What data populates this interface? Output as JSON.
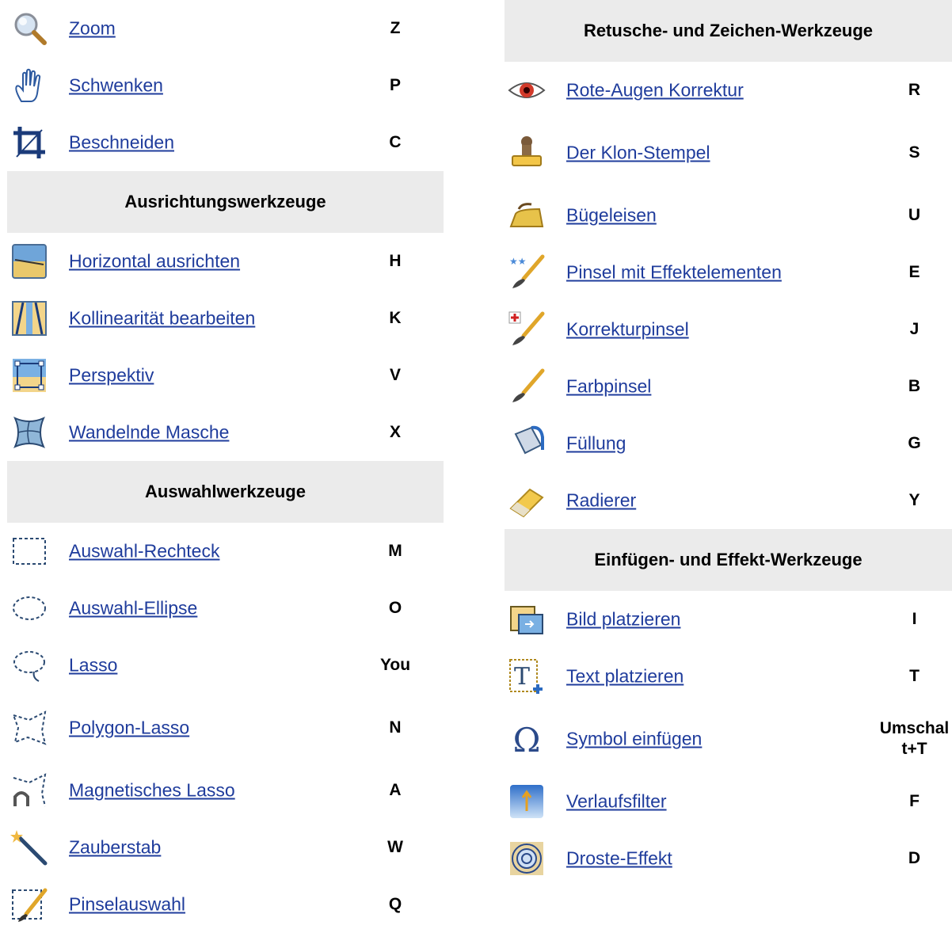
{
  "left": {
    "rows": [
      {
        "type": "tool",
        "icon": "zoom-icon",
        "label": "Zoom",
        "key": "Z"
      },
      {
        "type": "tool",
        "icon": "hand-icon",
        "label": "Schwenken",
        "key": "P"
      },
      {
        "type": "tool",
        "icon": "crop-icon",
        "label": "Beschneiden",
        "key": "C"
      },
      {
        "type": "header",
        "title": "Ausrichtungswerkzeuge"
      },
      {
        "type": "tool",
        "icon": "horizon-icon",
        "label": "Horizontal ausrichten",
        "key": "H"
      },
      {
        "type": "tool",
        "icon": "collinearity-icon",
        "label": "Kollinearität bearbeiten",
        "key": "K"
      },
      {
        "type": "tool",
        "icon": "perspective-icon",
        "label": "Perspektiv",
        "key": "V"
      },
      {
        "type": "tool",
        "icon": "mesh-warp-icon",
        "label": "Wandelnde Masche",
        "key": "X"
      },
      {
        "type": "header",
        "title": "Auswahlwerkzeuge"
      },
      {
        "type": "tool",
        "icon": "rect-select-icon",
        "label": "Auswahl-Rechteck",
        "key": "M"
      },
      {
        "type": "tool",
        "icon": "ellipse-select-icon",
        "label": "Auswahl-Ellipse",
        "key": "O"
      },
      {
        "type": "tool",
        "icon": "lasso-icon",
        "label": "Lasso",
        "key": "You"
      },
      {
        "type": "tool",
        "icon": "polygon-lasso-icon",
        "label": "Polygon-Lasso",
        "key": "N",
        "tall": true
      },
      {
        "type": "tool",
        "icon": "magnetic-lasso-icon",
        "label": "Magnetisches Lasso",
        "key": "A"
      },
      {
        "type": "tool",
        "icon": "magic-wand-icon",
        "label": "Zauberstab",
        "key": "W"
      },
      {
        "type": "tool",
        "icon": "brush-select-icon",
        "label": "Pinselauswahl",
        "key": "Q"
      }
    ]
  },
  "right": {
    "rows": [
      {
        "type": "header",
        "title": "Retusche- und Zeichen-Werkzeuge"
      },
      {
        "type": "tool",
        "icon": "red-eye-icon",
        "label": "Rote-Augen Korrektur",
        "key": "R"
      },
      {
        "type": "tool",
        "icon": "clone-stamp-icon",
        "label": "Der Klon-Stempel",
        "key": "S",
        "tall": true
      },
      {
        "type": "tool",
        "icon": "iron-icon",
        "label": "Bügeleisen",
        "key": "U"
      },
      {
        "type": "tool",
        "icon": "effects-brush-icon",
        "label": "Pinsel mit Effektelementen",
        "key": "E"
      },
      {
        "type": "tool",
        "icon": "healing-brush-icon",
        "label": "Korrekturpinsel",
        "key": "J"
      },
      {
        "type": "tool",
        "icon": "paint-brush-icon",
        "label": "Farbpinsel",
        "key": "B"
      },
      {
        "type": "tool",
        "icon": "fill-bucket-icon",
        "label": "Füllung",
        "key": "G"
      },
      {
        "type": "tool",
        "icon": "eraser-icon",
        "label": "Radierer",
        "key": "Y"
      },
      {
        "type": "header",
        "title": "Einfügen- und Effekt-Werkzeuge"
      },
      {
        "type": "tool",
        "icon": "place-image-icon",
        "label": "Bild platzieren",
        "key": "I"
      },
      {
        "type": "tool",
        "icon": "place-text-icon",
        "label": "Text platzieren",
        "key": "T"
      },
      {
        "type": "tool",
        "icon": "omega-symbol-icon",
        "label": "Symbol einfügen",
        "key": [
          "Umschal",
          "t+T"
        ],
        "tall": true
      },
      {
        "type": "tool",
        "icon": "gradient-filter-icon",
        "label": "Verlaufsfilter",
        "key": "F"
      },
      {
        "type": "tool",
        "icon": "droste-icon",
        "label": "Droste-Effekt",
        "key": "D"
      }
    ]
  }
}
